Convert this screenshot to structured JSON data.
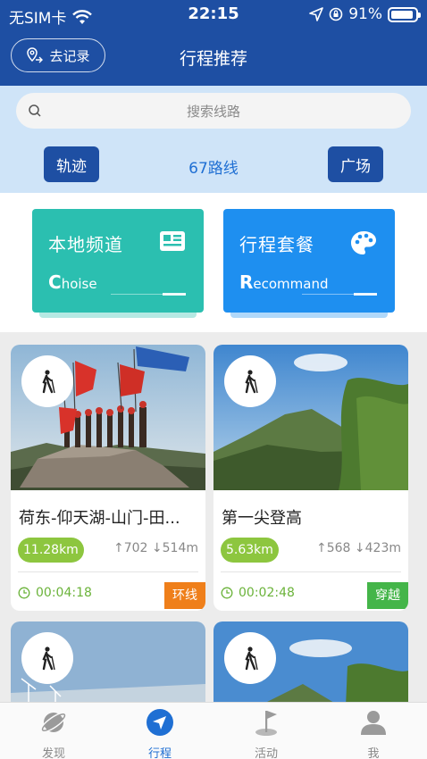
{
  "status_bar": {
    "carrier": "无SIM卡",
    "time": "22:15",
    "battery": "91%"
  },
  "header": {
    "record_label": "去记录",
    "title": "行程推荐"
  },
  "search": {
    "placeholder": "搜索线路"
  },
  "filters": {
    "track_label": "轨迹",
    "route_count": "67路线",
    "plaza_label": "广场"
  },
  "features": [
    {
      "title": "本地频道",
      "sub_first": "C",
      "sub_rest": "hoise",
      "color": "#2bbfb0"
    },
    {
      "title": "行程套餐",
      "sub_first": "R",
      "sub_rest": "ecommand",
      "color": "#1e8ff0"
    }
  ],
  "routes": [
    {
      "name": "荷东-仰天湖-山门-田...",
      "distance": "11.28km",
      "ascent": "702",
      "descent": "514m",
      "duration": "00:04:18",
      "tag": "环线",
      "tag_color": "#ef7f1a"
    },
    {
      "name": "第一尖登高",
      "distance": "5.63km",
      "ascent": "568",
      "descent": "423m",
      "duration": "00:02:48",
      "tag": "穿越",
      "tag_color": "#44b549"
    },
    {
      "name": "",
      "distance": "",
      "ascent": "",
      "descent": "",
      "duration": "",
      "tag": ""
    },
    {
      "name": "",
      "distance": "",
      "ascent": "",
      "descent": "",
      "duration": "",
      "tag": ""
    }
  ],
  "tabbar": {
    "items": [
      {
        "label": "发现",
        "icon": "planet-icon"
      },
      {
        "label": "行程",
        "icon": "navigation-arrow-icon"
      },
      {
        "label": "活动",
        "icon": "flag-icon"
      },
      {
        "label": "我",
        "icon": "user-icon"
      }
    ],
    "active_index": 1
  },
  "colors": {
    "header_blue": "#1e4fa3",
    "accent_blue": "#1f6fd3",
    "distance_green": "#8dc63f"
  }
}
